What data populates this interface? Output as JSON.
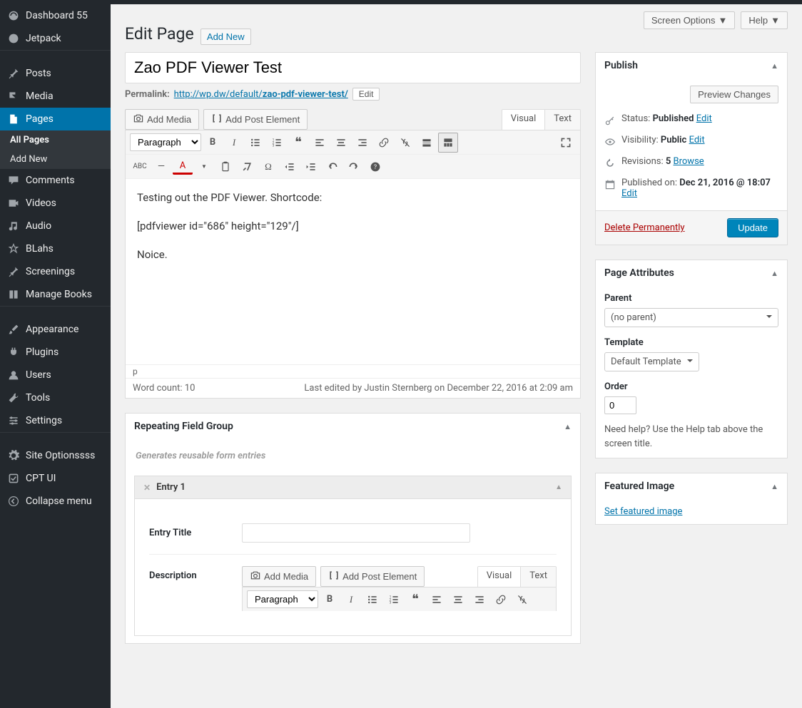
{
  "topbar": {
    "screen_options": "Screen Options",
    "help": "Help"
  },
  "sidebar": {
    "items": [
      {
        "label": "Dashboard 55"
      },
      {
        "label": "Jetpack"
      },
      {
        "label": "Posts"
      },
      {
        "label": "Media"
      },
      {
        "label": "Pages",
        "current": true
      },
      {
        "label": "Comments"
      },
      {
        "label": "Videos"
      },
      {
        "label": "Audio"
      },
      {
        "label": "BLahs"
      },
      {
        "label": "Screenings"
      },
      {
        "label": "Manage Books"
      },
      {
        "label": "Appearance"
      },
      {
        "label": "Plugins"
      },
      {
        "label": "Users"
      },
      {
        "label": "Tools"
      },
      {
        "label": "Settings"
      },
      {
        "label": "Site Optionssss"
      },
      {
        "label": "CPT UI"
      },
      {
        "label": "Collapse menu"
      }
    ],
    "submenu": {
      "all_pages": "All Pages",
      "add_new": "Add New"
    }
  },
  "header": {
    "title": "Edit Page",
    "add_new": "Add New"
  },
  "post": {
    "title": "Zao PDF Viewer Test",
    "permalink_label": "Permalink:",
    "permalink_base": "http://wp.dw/default/",
    "permalink_slug": "zao-pdf-viewer-test/",
    "edit": "Edit"
  },
  "editor_actions": {
    "add_media": "Add Media",
    "add_post_element": "Add Post Element",
    "tab_visual": "Visual",
    "tab_text": "Text",
    "format_select": "Paragraph"
  },
  "editor_content": {
    "line1": "Testing out the PDF Viewer. Shortcode:",
    "line2": "[pdfviewer id=\"686\" height=\"129\"/]",
    "line3": "Noice.",
    "path": "p",
    "word_count": "Word count: 10",
    "last_edit": "Last edited by Justin Sternberg on December 22, 2016 at 2:09 am"
  },
  "repeating": {
    "box_title": "Repeating Field Group",
    "desc": "Generates reusable form entries",
    "entry_label": "Entry 1",
    "field_title": "Entry Title",
    "field_desc": "Description",
    "add_media": "Add Media",
    "add_post_element": "Add Post Element",
    "tab_visual": "Visual",
    "tab_text": "Text",
    "format_select": "Paragraph"
  },
  "publish": {
    "box_title": "Publish",
    "preview": "Preview Changes",
    "status_label": "Status:",
    "status_value": "Published",
    "visibility_label": "Visibility:",
    "visibility_value": "Public",
    "revisions_label": "Revisions:",
    "revisions_value": "5",
    "browse": "Browse",
    "edit": "Edit",
    "published_label": "Published on:",
    "published_value": "Dec 21, 2016 @ 18:07",
    "delete": "Delete Permanently",
    "update": "Update"
  },
  "attributes": {
    "box_title": "Page Attributes",
    "parent_label": "Parent",
    "parent_value": "(no parent)",
    "template_label": "Template",
    "template_value": "Default Template",
    "order_label": "Order",
    "order_value": "0",
    "help": "Need help? Use the Help tab above the screen title."
  },
  "featured": {
    "box_title": "Featured Image",
    "link": "Set featured image"
  }
}
